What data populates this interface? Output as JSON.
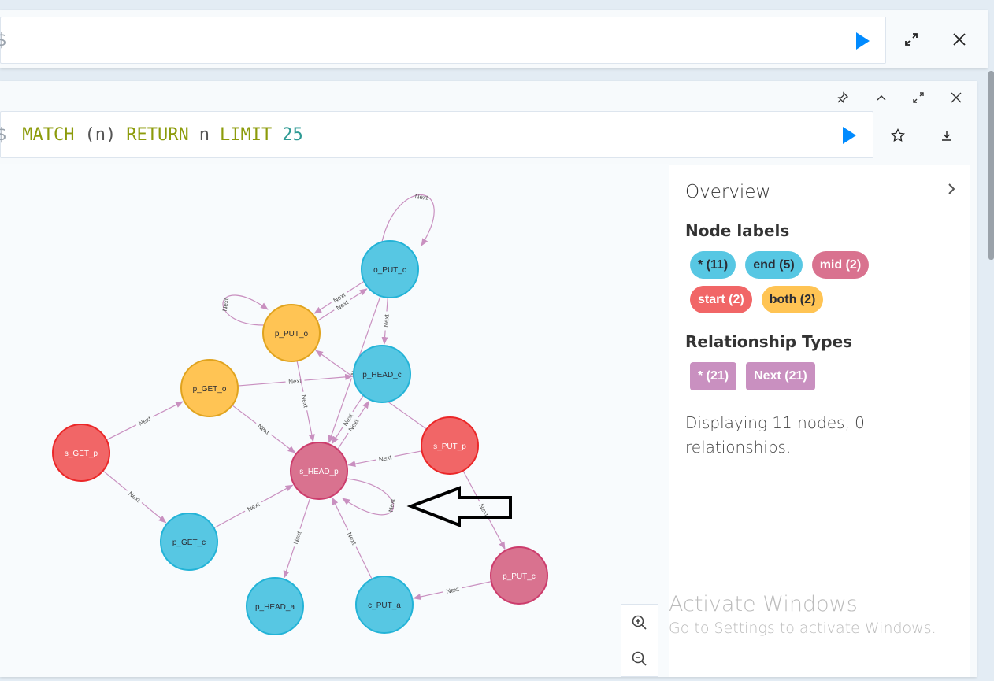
{
  "top_editor": {
    "prompt": "$"
  },
  "result_editor": {
    "prompt": "$",
    "query": {
      "kw1": "MATCH",
      "paren": "(n)",
      "kw2": "RETURN",
      "var": "n",
      "kw3": "LIMIT",
      "limit": "25"
    }
  },
  "icons": {
    "run": "play-icon",
    "expand": "expand-icon",
    "close": "close-icon",
    "pin": "pin-icon",
    "collapse": "chevron-up-icon",
    "star": "star-icon",
    "download": "download-icon"
  },
  "overview": {
    "title": "Overview",
    "node_labels_heading": "Node labels",
    "node_labels": [
      {
        "label": "* (11)",
        "bg": "#57c7e3",
        "fg": "#2a2c34"
      },
      {
        "label": "end (5)",
        "bg": "#57c7e3",
        "fg": "#2a2c34"
      },
      {
        "label": "mid (2)",
        "bg": "#d9728f",
        "fg": "#ffffff"
      },
      {
        "label": "start (2)",
        "bg": "#f16667",
        "fg": "#ffffff"
      },
      {
        "label": "both (2)",
        "bg": "#ffc454",
        "fg": "#2a2c34"
      }
    ],
    "rel_types_heading": "Relationship Types",
    "rel_types": [
      {
        "label": "* (21)"
      },
      {
        "label": "Next (21)"
      }
    ],
    "display_text": "Displaying 11 nodes, 0 relationships."
  },
  "graph": {
    "colors": {
      "end": "#57c7e3",
      "mid": "#d9728f",
      "start": "#f16667",
      "both": "#ffc454",
      "edge": "#c990c0"
    },
    "nodes": [
      {
        "id": "o_PUT_c",
        "type": "end"
      },
      {
        "id": "p_PUT_o",
        "type": "both"
      },
      {
        "id": "p_HEAD_c",
        "type": "end"
      },
      {
        "id": "p_GET_o",
        "type": "both"
      },
      {
        "id": "s_GET_p",
        "type": "start"
      },
      {
        "id": "s_HEAD_p",
        "type": "mid"
      },
      {
        "id": "s_PUT_p",
        "type": "start"
      },
      {
        "id": "p_GET_c",
        "type": "end"
      },
      {
        "id": "p_HEAD_a",
        "type": "end"
      },
      {
        "id": "c_PUT_a",
        "type": "end"
      },
      {
        "id": "p_PUT_c",
        "type": "mid"
      }
    ],
    "edge_label": "Next",
    "edges": [
      [
        "o_PUT_c",
        "o_PUT_c"
      ],
      [
        "p_PUT_o",
        "p_PUT_o"
      ],
      [
        "p_PUT_o",
        "o_PUT_c"
      ],
      [
        "o_PUT_c",
        "p_PUT_o"
      ],
      [
        "o_PUT_c",
        "p_HEAD_c"
      ],
      [
        "o_PUT_c",
        "s_HEAD_p"
      ],
      [
        "s_PUT_p",
        "p_PUT_o"
      ],
      [
        "p_GET_o",
        "p_HEAD_c"
      ],
      [
        "p_PUT_o",
        "s_HEAD_p"
      ],
      [
        "s_GET_p",
        "p_GET_o"
      ],
      [
        "s_GET_p",
        "p_GET_c"
      ],
      [
        "p_GET_o",
        "s_HEAD_p"
      ],
      [
        "s_HEAD_p",
        "p_HEAD_c"
      ],
      [
        "p_HEAD_c",
        "s_HEAD_p"
      ],
      [
        "s_PUT_p",
        "s_HEAD_p"
      ],
      [
        "s_HEAD_p",
        "s_HEAD_p"
      ],
      [
        "p_GET_c",
        "s_HEAD_p"
      ],
      [
        "s_HEAD_p",
        "p_HEAD_a"
      ],
      [
        "c_PUT_a",
        "s_HEAD_p"
      ],
      [
        "p_PUT_c",
        "c_PUT_a"
      ],
      [
        "s_PUT_p",
        "p_PUT_c"
      ]
    ]
  },
  "zoom": {
    "in": "zoom-in-icon",
    "out": "zoom-out-icon"
  },
  "watermark": {
    "line1": "Activate Windows",
    "line2": "Go to Settings to activate Windows."
  }
}
